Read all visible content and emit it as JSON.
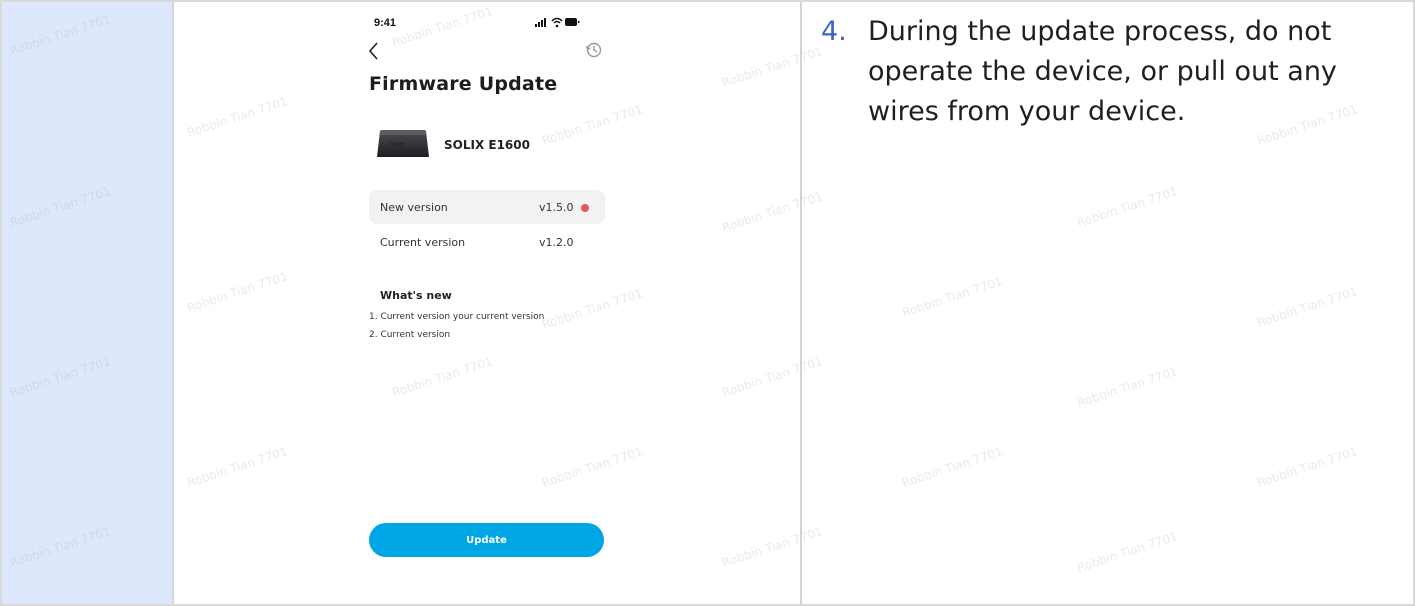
{
  "status_bar": {
    "time": "9:41"
  },
  "screen": {
    "title": "Firmware Update",
    "device_name": "SOLIX E1600"
  },
  "versions": {
    "new_label": "New version",
    "new_value": "v1.5.0",
    "current_label": "Current version",
    "current_value": "v1.2.0"
  },
  "whats_new": {
    "title": "What's new",
    "notes": [
      "1. Current version your current version",
      "2. Current version"
    ]
  },
  "update_button": {
    "label": "Update"
  },
  "instruction": {
    "number": "4.",
    "text": "During the update process, do not operate the device, or pull out any wires from your device."
  },
  "watermark": "Robbin Tian 7701",
  "colors": {
    "accent_button": "#00a6e3",
    "badge_red": "#e4575f",
    "sidebar_blue": "#dde8fd",
    "step_number_blue": "#3c64c8"
  }
}
